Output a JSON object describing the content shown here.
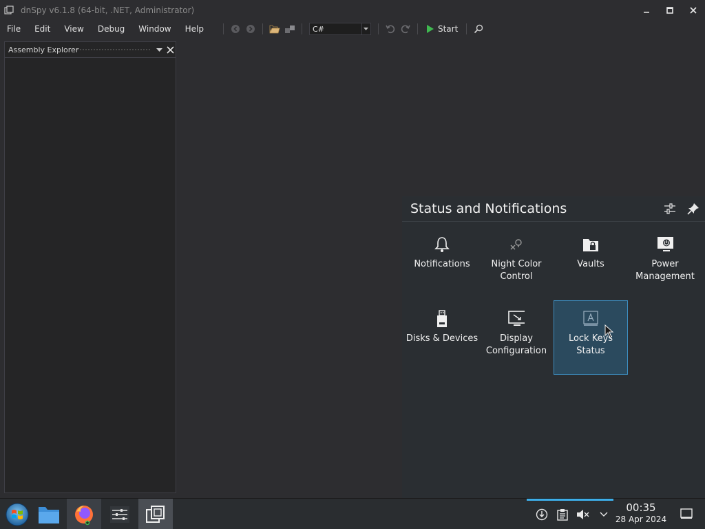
{
  "window": {
    "title": "dnSpy v6.1.8 (64-bit, .NET, Administrator)"
  },
  "menu": {
    "items": [
      "File",
      "Edit",
      "View",
      "Debug",
      "Window",
      "Help"
    ]
  },
  "toolbar": {
    "language": "C#",
    "start_label": "Start"
  },
  "assembly_explorer": {
    "title": "Assembly Explorer"
  },
  "status_popup": {
    "title": "Status and Notifications",
    "tiles": [
      {
        "label": "Notifications",
        "icon": "bell-icon"
      },
      {
        "label": "Night Color\nControl",
        "icon": "night-color-icon"
      },
      {
        "label": "Vaults",
        "icon": "vault-icon"
      },
      {
        "label": "Power\nManagement",
        "icon": "power-management-icon"
      },
      {
        "label": "Disks & Devices",
        "icon": "usb-drive-icon"
      },
      {
        "label": "Display\nConfiguration",
        "icon": "display-icon"
      },
      {
        "label": "Lock Keys\nStatus",
        "icon": "lock-keys-icon",
        "selected": true
      }
    ]
  },
  "taskbar": {
    "clock_time": "00:35",
    "clock_date": "28 Apr 2024"
  },
  "colors": {
    "accent": "#3daee9",
    "selected_tile_bg": "#2b4a5e",
    "window_bg": "#2d2d30"
  }
}
